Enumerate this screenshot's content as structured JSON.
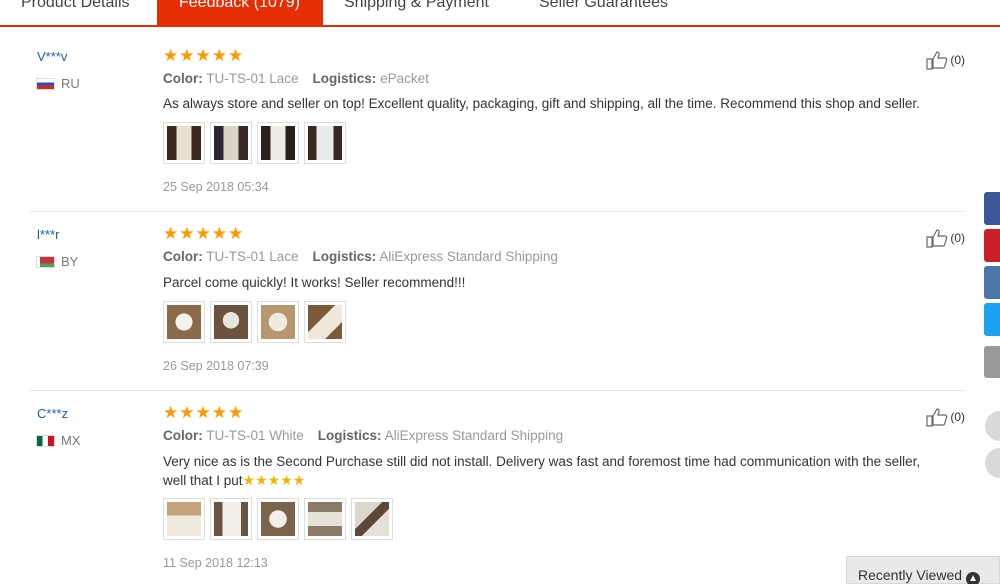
{
  "tabs": [
    {
      "label": "Product Details",
      "active": false
    },
    {
      "label": "Feedback (1079)",
      "active": true
    },
    {
      "label": "Shipping & Payment",
      "active": false
    },
    {
      "label": "Seller Guarantees",
      "active": false
    }
  ],
  "reviews": [
    {
      "user": "V***v",
      "country": "RU",
      "rating": 5,
      "color_label": "Color:",
      "color": "TU-TS-01 Lace",
      "logistics_label": "Logistics:",
      "logistics": "ePacket",
      "text": "As always store and seller on top! Excellent quality, packaging, gift and shipping, all the time. Recommend this shop and seller.",
      "photo_count": 4,
      "date": "25 Sep 2018 05:34",
      "likes": "(0)"
    },
    {
      "user": "l***r",
      "country": "BY",
      "rating": 5,
      "color_label": "Color:",
      "color": "TU-TS-01 Lace",
      "logistics_label": "Logistics:",
      "logistics": "AliExpress Standard Shipping",
      "text": "Parcel come quickly! It works! Seller recommend!!!",
      "photo_count": 4,
      "date": "26 Sep 2018 07:39",
      "likes": "(0)"
    },
    {
      "user": "C***z",
      "country": "MX",
      "rating": 5,
      "color_label": "Color:",
      "color": "TU-TS-01 White",
      "logistics_label": "Logistics:",
      "logistics": "AliExpress Standard Shipping",
      "text_line1": "Very nice as is the Second Purchase still did not install. Delivery was fast and foremost time had communication with the seller,",
      "text_line2": "well that I put",
      "text_stars": "★★★★★",
      "photo_count": 5,
      "date": "11 Sep 2018 12:13",
      "likes": "(0)"
    }
  ],
  "share_colors": [
    "#3b5998",
    "#cb2027",
    "#4a76a8",
    "#1da1f2",
    "#999999"
  ],
  "recently_viewed": "Recently Viewed",
  "colors": {
    "accent": "#e62e04",
    "star": "#ff9900",
    "link": "#1a5fb4"
  }
}
